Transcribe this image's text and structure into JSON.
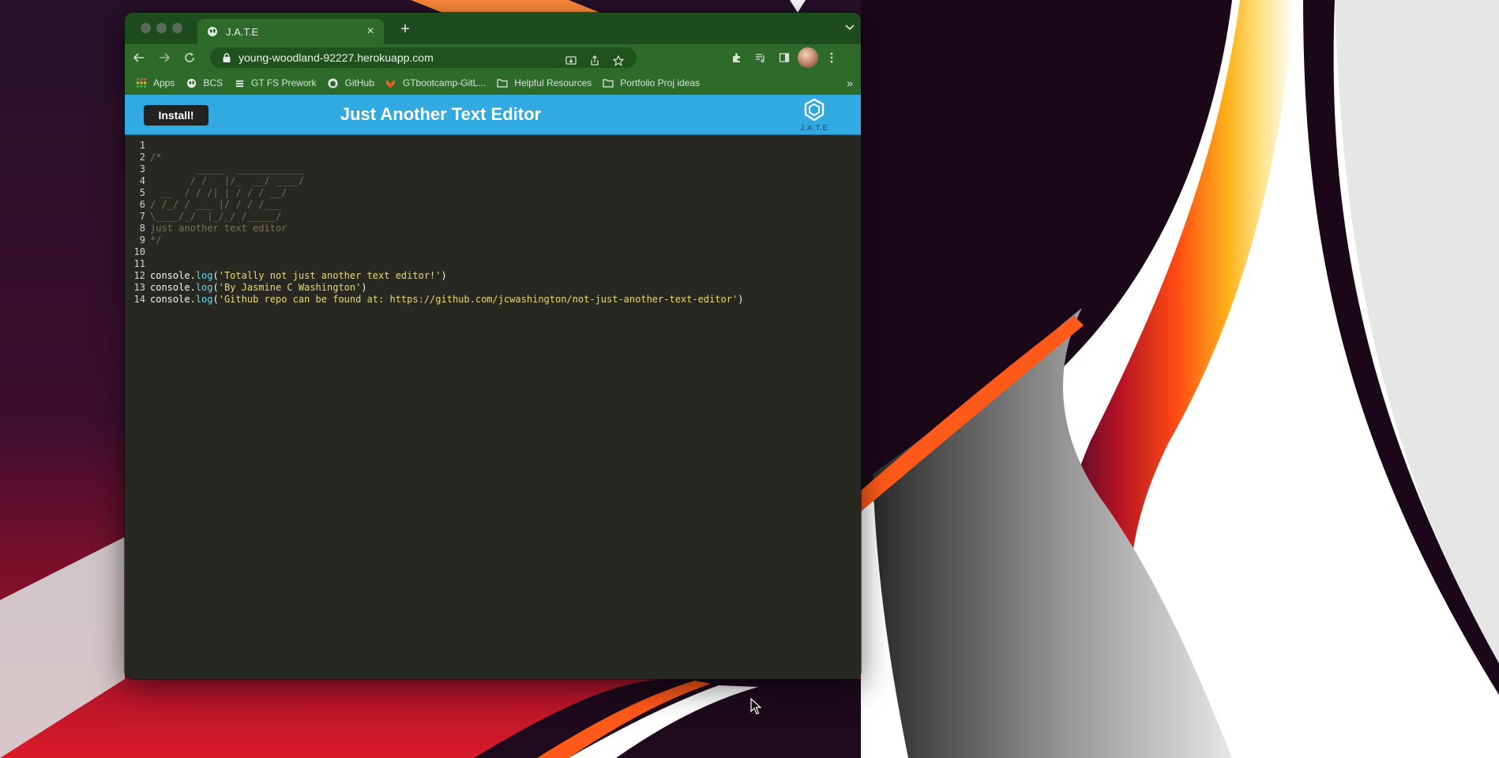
{
  "browser": {
    "tab_title": "J.A.T.E",
    "url": "young-woodland-92227.herokuapp.com",
    "bookmarks": [
      {
        "label": "Apps",
        "icon": "apps-grid-icon"
      },
      {
        "label": "BCS",
        "icon": "globe-icon"
      },
      {
        "label": "GT FS Prework",
        "icon": "stack-icon"
      },
      {
        "label": "GitHub",
        "icon": "github-icon"
      },
      {
        "label": "GTbootcamp-GitL...",
        "icon": "gitlab-icon"
      },
      {
        "label": "Helpful Resources",
        "icon": "folder-icon"
      },
      {
        "label": "Portfolio Proj ideas",
        "icon": "folder-icon"
      }
    ],
    "more_bookmarks": "»"
  },
  "app": {
    "install_label": "Install!",
    "title": "Just Another Text Editor",
    "logo_text": "J.A.T.E"
  },
  "editor": {
    "lines": [
      {
        "n": "1",
        "text": ""
      },
      {
        "n": "2",
        "text": "/*"
      },
      {
        "n": "3",
        "text": "        _____  ____________"
      },
      {
        "n": "4",
        "text": "       / /   |/_  __/ ____/"
      },
      {
        "n": "5",
        "text": "  __  / / /| | / / / __/"
      },
      {
        "n": "6",
        "text": "/ /_/ / ___ |/ / / /___"
      },
      {
        "n": "7",
        "text": "\\____/_/  |_/_/ /_____/"
      },
      {
        "n": "8",
        "text": "just another text editor"
      },
      {
        "n": "9",
        "text": "*/"
      },
      {
        "n": "10",
        "text": ""
      },
      {
        "n": "11",
        "text": ""
      },
      {
        "n": "12",
        "obj": "console",
        "method": "log",
        "str": "'Totally not just another text editor!'"
      },
      {
        "n": "13",
        "obj": "console",
        "method": "log",
        "str": "'By Jasmine C Washington'"
      },
      {
        "n": "14",
        "obj": "console",
        "method": "log",
        "str": "'Github repo can be found at: https://github.com/jcwashington/not-just-another-text-editor'"
      }
    ]
  },
  "colors": {
    "app_header": "#31a9e1",
    "browser_chrome": "#2e6b2a",
    "editor_bg": "#272822",
    "comment": "#75715e",
    "string": "#e6db74"
  }
}
